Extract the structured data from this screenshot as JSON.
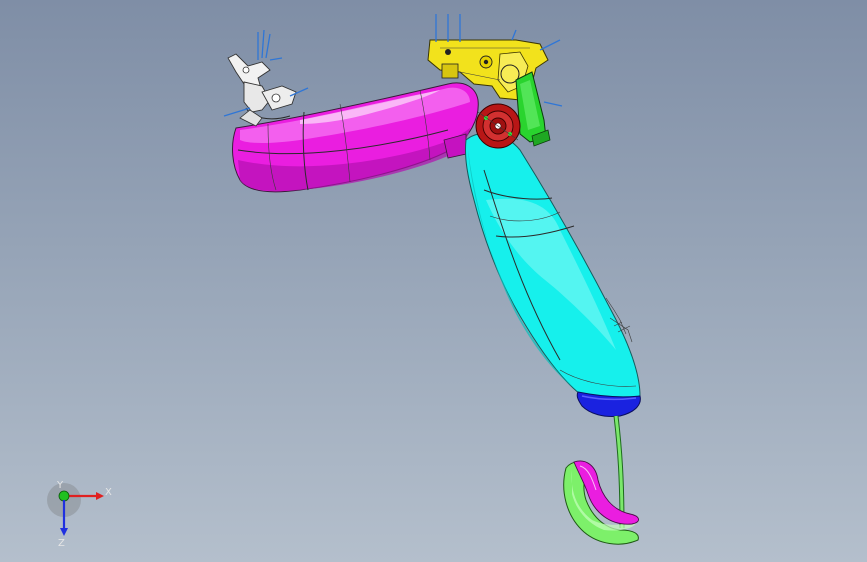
{
  "viewer": {
    "background_top": "#7f8ea6",
    "background_bottom": "#b4bfcc"
  },
  "parts": [
    {
      "name": "magenta-curved-panel",
      "color": "#ea1ee0"
    },
    {
      "name": "cyan-curved-panel",
      "color": "#16f0ec"
    },
    {
      "name": "yellow-bracket-mechanism",
      "color": "#f2e21c"
    },
    {
      "name": "red-hub-assembly",
      "color": "#b81616"
    },
    {
      "name": "green-side-plate",
      "color": "#29d42e"
    },
    {
      "name": "blue-panel-end-cap",
      "color": "#1a22e0"
    },
    {
      "name": "green-support-rod",
      "color": "#7be86b"
    },
    {
      "name": "green-foot-loop",
      "color": "#7df06a"
    },
    {
      "name": "white-hinge-mount",
      "color": "#f2f2f2"
    }
  ],
  "triad": {
    "x_label": "X",
    "y_label": "Y",
    "z_label": "Z",
    "x_color": "#e02020",
    "y_color": "#20c020",
    "z_color": "#2030e0"
  }
}
